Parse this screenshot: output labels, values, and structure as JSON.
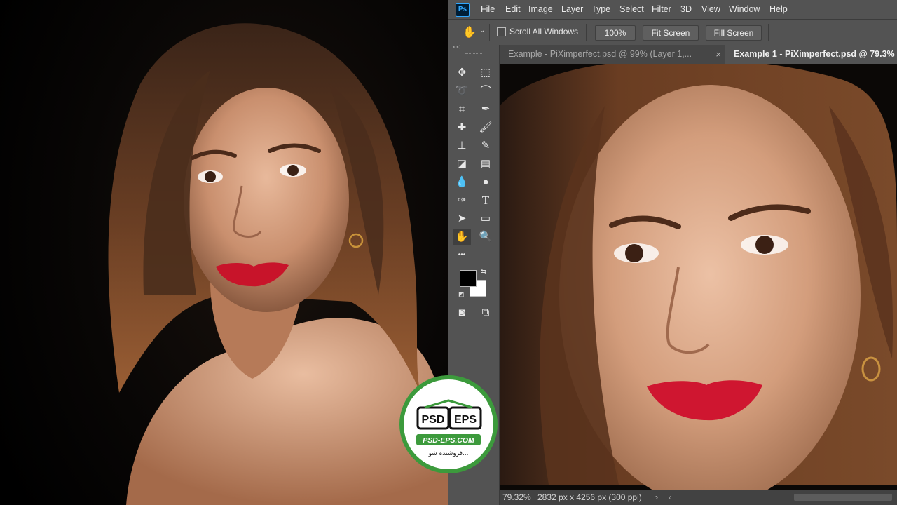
{
  "menu": {
    "logo": "Ps",
    "items": [
      "File",
      "Edit",
      "Image",
      "Layer",
      "Type",
      "Select",
      "Filter",
      "3D",
      "View",
      "Window",
      "Help"
    ]
  },
  "options": {
    "scroll_all_windows": "Scroll All Windows",
    "zoom_value": "100%",
    "fit_screen": "Fit Screen",
    "fill_screen": "Fill Screen"
  },
  "toolbar": {
    "collapse": "<<",
    "more": "•••"
  },
  "tabs": [
    {
      "label": "Example - PiXimperfect.psd @ 99% (Layer 1,...",
      "close": "×"
    },
    {
      "label": "Example 1 - PiXimperfect.psd @ 79.3%",
      "close": ""
    }
  ],
  "status": {
    "zoom": "79.32%",
    "dimensions": "2832 px x 4256 px (300 ppi)",
    "arrow": "›",
    "scroll_left": "‹"
  },
  "watermark": {
    "psd": "PSD",
    "eps": "EPS",
    "site": "PSD-EPS.COM",
    "tagline": "فروشنده شو..."
  },
  "colors": {
    "foreground": "#000000",
    "background": "#ffffff",
    "accent_green": "#3c9a3c"
  }
}
